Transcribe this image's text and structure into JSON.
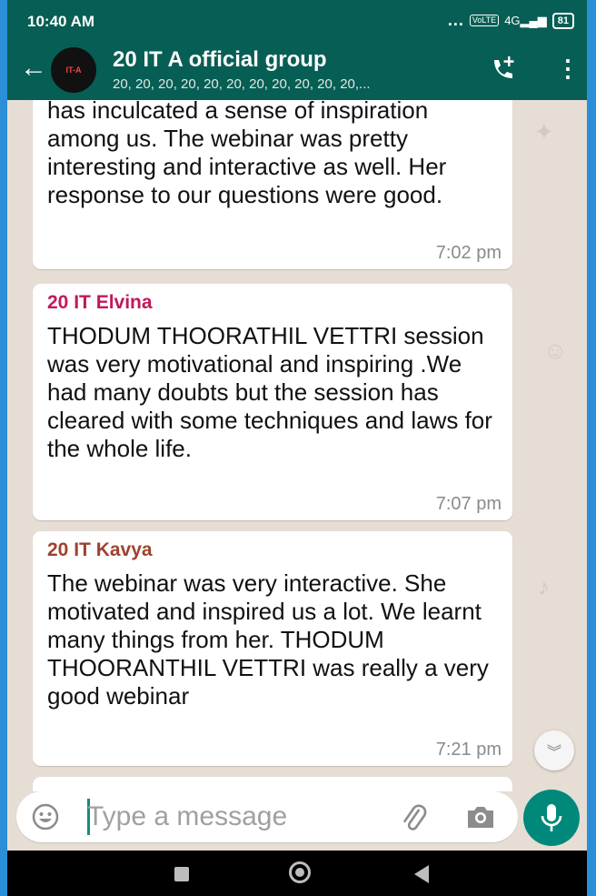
{
  "status_bar": {
    "time": "10:40 AM",
    "dots": "...",
    "volte": "VoLTE",
    "network": "4G",
    "battery": "81"
  },
  "header": {
    "title": "20 IT A official group",
    "subtitle": "20, 20, 20, 20, 20, 20, 20, 20, 20, 20, 20,...",
    "avatar_text": "IT-A",
    "menu_glyph": "⋮"
  },
  "messages": [
    {
      "sender": "",
      "text": "has inculcated a sense of inspiration among us. The webinar was pretty interesting and interactive as well. Her response to our questions were good.",
      "time": "7:02 pm"
    },
    {
      "sender": "20 IT Elvina",
      "sender_color": "#c2185b",
      "text": "THODUM THOORATHIL VETTRI session was very motivational and inspiring .We had many doubts but the session has cleared with some techniques and laws for the whole life.",
      "time": "7:07 pm"
    },
    {
      "sender": "20 IT Kavya",
      "sender_color": "#a0412d",
      "text": "The webinar was very interactive. She motivated and inspired us a lot. We learnt many things from her. THODUM THOORANTHIL VETTRI was really a very good webinar",
      "time": "7:21 pm"
    }
  ],
  "input": {
    "placeholder": "Type a message"
  },
  "colors": {
    "header_bg": "#075e54",
    "mic_bg": "#00897b",
    "chat_bg": "#e6ddd4"
  }
}
